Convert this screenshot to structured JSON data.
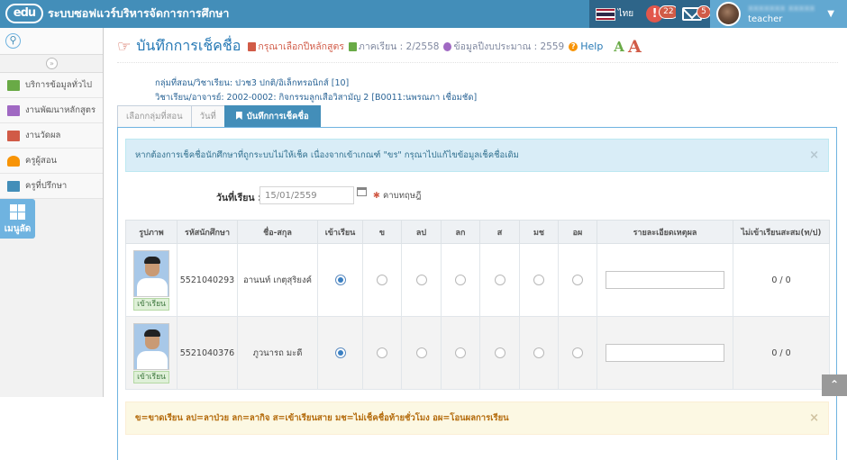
{
  "navbar": {
    "logo": "edu",
    "title": "ระบบซอฟแวร์บริหารจัดการการศึกษา",
    "lang_label": "ไทย",
    "alert_count": "22",
    "alert_symbol": "!",
    "mail_count": "5",
    "user_name": "xxxxxxx xxxxx",
    "user_role": "teacher",
    "caret": "▼"
  },
  "sidebar": {
    "items": [
      {
        "label": "บริการข้อมูลทั่วไป",
        "icon": "monitor-icon",
        "color": "#69aa46"
      },
      {
        "label": "งานพัฒนาหลักสูตร",
        "icon": "book-icon",
        "color": "#a069c3"
      },
      {
        "label": "งานวัดผล",
        "icon": "chart-icon",
        "color": "#d15b47"
      },
      {
        "label": "ครูผู้สอน",
        "icon": "user-icon",
        "color": "#f89406"
      },
      {
        "label": "ครูที่ปรึกษา",
        "icon": "laptop-icon",
        "color": "#438eb9"
      }
    ],
    "tile_label": "เมนูลัด"
  },
  "header": {
    "title": "บันทึกการเช็คชื่อ",
    "course": "กรุณาเลือกปีหลักสูตร",
    "term": "ภาคเรียน : 2/2558",
    "budget": "ข้อมูลปีงบประมาณ : 2559",
    "help": "Help",
    "font_small": "A",
    "font_large": "A"
  },
  "info": {
    "line1": "กลุ่มที่สอน/วิชาเรียน: ปวช3 ปกติ/อิเล็กทรอนิกส์ [10]",
    "line2": "วิชาเรียน/อาจารย์: 2002-0002: กิจกรรมลูกเสือวิสามัญ 2 [B0011:นพรณภา เชื่อมชัด]"
  },
  "tabs": [
    "เลือกกลุ่มที่สอน",
    "วันที่",
    "บันทึกการเช็คชื่อ"
  ],
  "notice": "หากต้องการเช็คชื่อนักศึกษาที่ถูกระบบไม่ให้เช็ค เนื่องจากเข้าเกณฑ์ \"ขร\" กรุณาไปแก้ไขข้อมูลเช็คชื่อเดิม",
  "close_symbol": "×",
  "form": {
    "date_label": "วันที่เรียน :",
    "date_value": "15/01/2559",
    "period": "คาบทฤษฎี"
  },
  "table": {
    "headers": [
      "รูปภาพ",
      "รหัสนักศึกษา",
      "ชื่อ-สกุล",
      "เข้าเรียน",
      "ข",
      "ลป",
      "ลก",
      "ส",
      "มช",
      "อผ",
      "รายละเอียดเหตุผล",
      "ไม่เข้าเรียนสะสม(ท/ป)"
    ],
    "rows": [
      {
        "status": "เข้าเรียน",
        "id": "5521040293",
        "name": "อานนท์ เกตุสุริยงค์",
        "selected": 0,
        "absent": "0 / 0"
      },
      {
        "status": "เข้าเรียน",
        "id": "5521040376",
        "name": "ภูวนารถ มะดี",
        "selected": 0,
        "absent": "0 / 0"
      }
    ]
  },
  "legend": "ข=ขาดเรียน ลป=ลาป่วย ลก=ลากิจ ส=เข้าเรียนสาย มช=ไม่เช็คชื่อท้ายชั่วโมง อผ=โอนผลการเรียน",
  "scroll_top_symbol": "⌃"
}
